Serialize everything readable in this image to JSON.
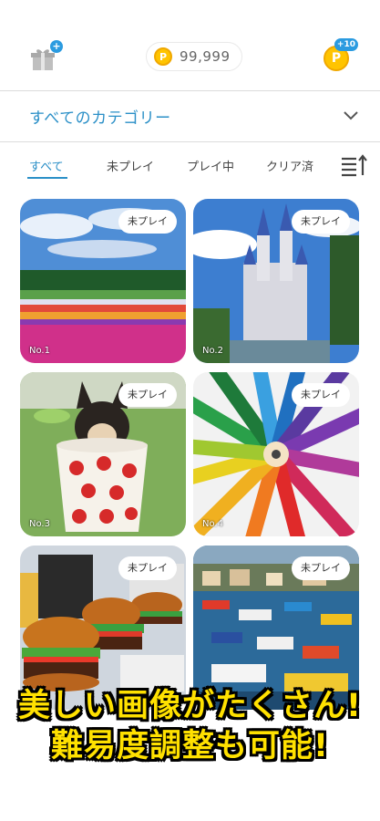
{
  "header": {
    "gift_badge": "+",
    "coin_symbol": "P",
    "coin_amount": "99,999",
    "bonus_symbol": "P",
    "bonus_badge": "+10"
  },
  "category": {
    "selected": "すべてのカテゴリー"
  },
  "tabs": [
    {
      "label": "すべて",
      "active": true
    },
    {
      "label": "未プレイ",
      "active": false
    },
    {
      "label": "プレイ中",
      "active": false
    },
    {
      "label": "クリア済",
      "active": false
    }
  ],
  "puzzles": [
    {
      "number": "No.1",
      "status": "未プレイ",
      "image": "flower-field"
    },
    {
      "number": "No.2",
      "status": "未プレイ",
      "image": "castle"
    },
    {
      "number": "No.3",
      "status": "未プレイ",
      "image": "puppy-in-cup"
    },
    {
      "number": "No.4",
      "status": "未プレイ",
      "image": "colored-pencils"
    },
    {
      "number": "",
      "status": "未プレイ",
      "image": "burgers"
    },
    {
      "number": "",
      "status": "未プレイ",
      "image": "harbor-boats"
    }
  ],
  "caption": {
    "line1": "美しい画像がたくさん!",
    "line2": "難易度調整も可能!"
  },
  "colors": {
    "accent": "#2a8fc7",
    "coin": "#ffc400",
    "caption_text": "#ffe100"
  }
}
